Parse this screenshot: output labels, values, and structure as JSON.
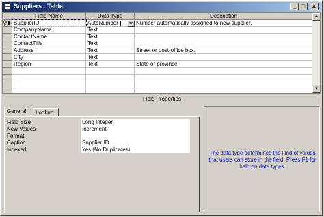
{
  "window": {
    "title": "Suppliers : Table"
  },
  "grid": {
    "headers": [
      "Field Name",
      "Data Type",
      "Description"
    ],
    "rows": [
      {
        "name": "SupplierID",
        "type": "AutoNumber",
        "desc": "Number automatically assigned to new supplier."
      },
      {
        "name": "CompanyName",
        "type": "Text",
        "desc": ""
      },
      {
        "name": "ContactName",
        "type": "Text",
        "desc": ""
      },
      {
        "name": "ContactTitle",
        "type": "Text",
        "desc": ""
      },
      {
        "name": "Address",
        "type": "Text",
        "desc": "Street or post-office box."
      },
      {
        "name": "City",
        "type": "Text",
        "desc": ""
      },
      {
        "name": "Region",
        "type": "Text",
        "desc": "State or province."
      },
      {
        "name": "",
        "type": "",
        "desc": ""
      },
      {
        "name": "",
        "type": "",
        "desc": ""
      },
      {
        "name": "",
        "type": "",
        "desc": ""
      },
      {
        "name": "",
        "type": "",
        "desc": ""
      }
    ]
  },
  "field_properties": {
    "label": "Field Properties",
    "tabs": [
      "General",
      "Lookup"
    ],
    "active_tab": "General",
    "props": [
      {
        "label": "Field Size",
        "value": "Long Integer"
      },
      {
        "label": "New Values",
        "value": "Increment"
      },
      {
        "label": "Format",
        "value": ""
      },
      {
        "label": "Caption",
        "value": "Supplier ID"
      },
      {
        "label": "Indexed",
        "value": "Yes (No Duplicates)"
      }
    ],
    "help_text": "The data type determines the kind of values that users can store in the field. Press F1 for help on data types."
  }
}
